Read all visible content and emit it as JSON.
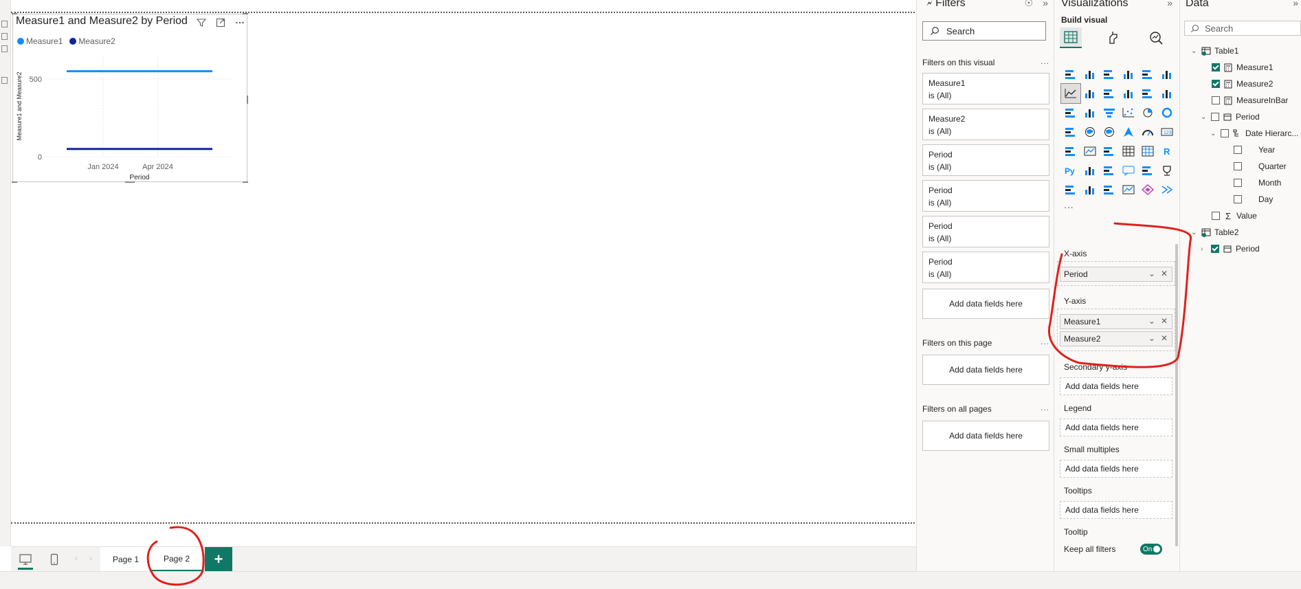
{
  "visual": {
    "title": "Measure1 and Measure2 by Period",
    "legend": [
      {
        "name": "Measure1",
        "color": "#118DFF"
      },
      {
        "name": "Measure2",
        "color": "#12239E"
      }
    ],
    "header_icons": [
      "filter-icon",
      "focus-mode-icon",
      "more-options-icon"
    ]
  },
  "chart_data": {
    "type": "line",
    "title": "Measure1 and Measure2 by Period",
    "xlabel": "Period",
    "ylabel": "Measure1 and Measure2",
    "x_ticks": [
      "Jan 2024",
      "Apr 2024"
    ],
    "y_ticks": [
      0,
      500
    ],
    "ylim": [
      0,
      650
    ],
    "x": [
      "Nov 2023",
      "Jul 2024"
    ],
    "series": [
      {
        "name": "Measure1",
        "color": "#118DFF",
        "values": [
          550,
          550
        ]
      },
      {
        "name": "Measure2",
        "color": "#12239E",
        "values": [
          50,
          50
        ]
      }
    ],
    "grid": true,
    "legend_position": "top-left"
  },
  "pages": {
    "tabs": [
      {
        "label": "Page 1",
        "active": false
      },
      {
        "label": "Page 2",
        "active": true
      }
    ],
    "add_label": "+"
  },
  "filters": {
    "title": "Filters",
    "search_placeholder": "Search",
    "on_visual_title": "Filters on this visual",
    "cards": [
      {
        "field": "Measure1",
        "state": "is (All)"
      },
      {
        "field": "Measure2",
        "state": "is (All)"
      },
      {
        "field": "Period",
        "state": "is (All)"
      },
      {
        "field": "Period",
        "state": "is (All)"
      },
      {
        "field": "Period",
        "state": "is (All)"
      },
      {
        "field": "Period",
        "state": "is (All)"
      }
    ],
    "add_fields": "Add data fields here",
    "on_page_title": "Filters on this page",
    "on_all_pages_title": "Filters on all pages",
    "more": "..."
  },
  "visualizations": {
    "title": "Visualizations",
    "build_visual": "Build visual",
    "more": "...",
    "wells": {
      "x_axis": {
        "label": "X-axis",
        "fields": [
          "Period"
        ]
      },
      "y_axis": {
        "label": "Y-axis",
        "fields": [
          "Measure1",
          "Measure2"
        ]
      },
      "secondary_y": {
        "label": "Secondary y-axis"
      },
      "legend": {
        "label": "Legend"
      },
      "small_multiples": {
        "label": "Small multiples"
      },
      "tooltips": {
        "label": "Tooltips"
      }
    },
    "add_fields": "Add data fields here",
    "tooltip_section": "Tooltip",
    "keep_all_filters": "Keep all filters",
    "toggle_state": "On"
  },
  "data": {
    "title": "Data",
    "search_placeholder": "Search",
    "tables": [
      {
        "name": "Table1",
        "fields": [
          "Measure1",
          "Measure2",
          "MeasureInBar",
          "Period",
          "Date Hierarchy",
          "Year",
          "Quarter",
          "Month",
          "Day",
          "Value"
        ]
      },
      {
        "name": "Table2",
        "fields": [
          "Period"
        ]
      }
    ],
    "tree": {
      "table1": "Table1",
      "measure1": "Measure1",
      "measure2": "Measure2",
      "measureinbar": "MeasureInBar",
      "period": "Period",
      "date_hierarchy": "Date Hierarc...",
      "year": "Year",
      "quarter": "Quarter",
      "month": "Month",
      "day": "Day",
      "value": "Value",
      "table2": "Table2",
      "period2": "Period"
    }
  },
  "colors": {
    "accent": "#117865",
    "annotation": "#E0201B"
  }
}
